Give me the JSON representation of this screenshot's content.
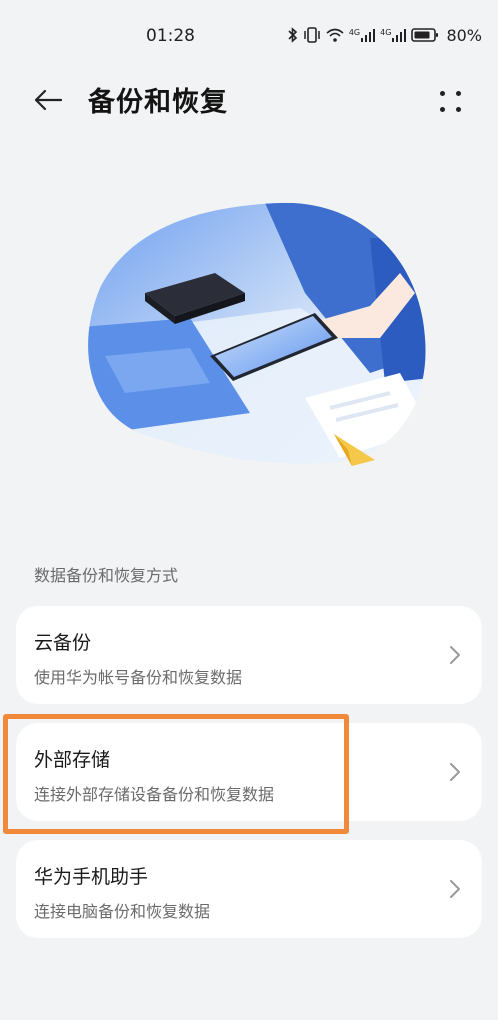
{
  "status_bar": {
    "time": "01:28",
    "network_label_1": "4G",
    "network_label_2": "4G",
    "battery_percent": "80%",
    "icons": [
      "bluetooth-icon",
      "vibrate-icon",
      "wifi-icon",
      "signal-icon",
      "signal-icon",
      "battery-icon"
    ]
  },
  "app_bar": {
    "back_icon": "arrow-left-icon",
    "title": "备份和恢复",
    "more_icon": "four-dots-icon"
  },
  "section_header": "数据备份和恢复方式",
  "options": [
    {
      "title": "云备份",
      "subtitle": "使用华为帐号备份和恢复数据"
    },
    {
      "title": "外部存储",
      "subtitle": "连接外部存储设备备份和恢复数据"
    },
    {
      "title": "华为手机助手",
      "subtitle": "连接电脑备份和恢复数据"
    }
  ],
  "colors": {
    "background": "#f1f3f5",
    "card": "#ffffff",
    "highlight": "#f08a3a",
    "illustration_blue": "#4f86e6"
  }
}
